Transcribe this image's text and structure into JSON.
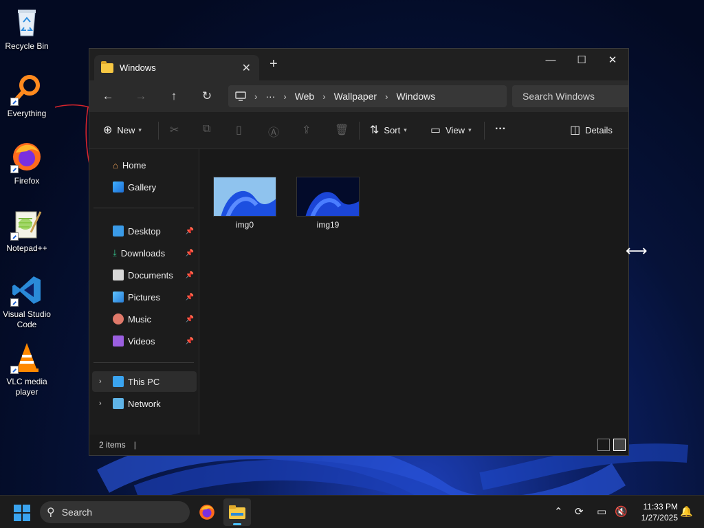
{
  "desktop": {
    "icons": [
      {
        "label": "Recycle Bin"
      },
      {
        "label": "Everything"
      },
      {
        "label": "Firefox"
      },
      {
        "label": "Notepad++"
      },
      {
        "label": "Visual Studio Code"
      },
      {
        "label": "VLC media player"
      }
    ]
  },
  "explorer": {
    "tab_title": "Windows",
    "tab_close_glyph": "✕",
    "new_tab_glyph": "+",
    "window_controls": {
      "minimize": "—",
      "maximize": "☐",
      "close": "✕"
    },
    "nav": {
      "back": "←",
      "forward": "→",
      "up": "↑",
      "refresh": "↻"
    },
    "breadcrumb": [
      "Web",
      "Wallpaper",
      "Windows"
    ],
    "breadcrumb_more": "···",
    "search_placeholder": "Search Windows",
    "toolbar": {
      "new_label": "New",
      "sort_label": "Sort",
      "view_label": "View",
      "more_label": "···",
      "details_label": "Details"
    },
    "sidebar": {
      "home": "Home",
      "gallery": "Gallery",
      "quick_access": [
        "Desktop",
        "Downloads",
        "Documents",
        "Pictures",
        "Music",
        "Videos"
      ],
      "this_pc": "This PC",
      "network": "Network"
    },
    "files": [
      {
        "name": "img0"
      },
      {
        "name": "img19"
      }
    ],
    "status": {
      "item_count": "2 items",
      "caret": "|"
    }
  },
  "taskbar": {
    "search_label": "Search",
    "time": "11:33 PM",
    "date": "1/27/2025"
  },
  "colors": {
    "accent": "#4cc2ff",
    "window_bg": "#191919",
    "start_blue": "#3aa4f0"
  }
}
